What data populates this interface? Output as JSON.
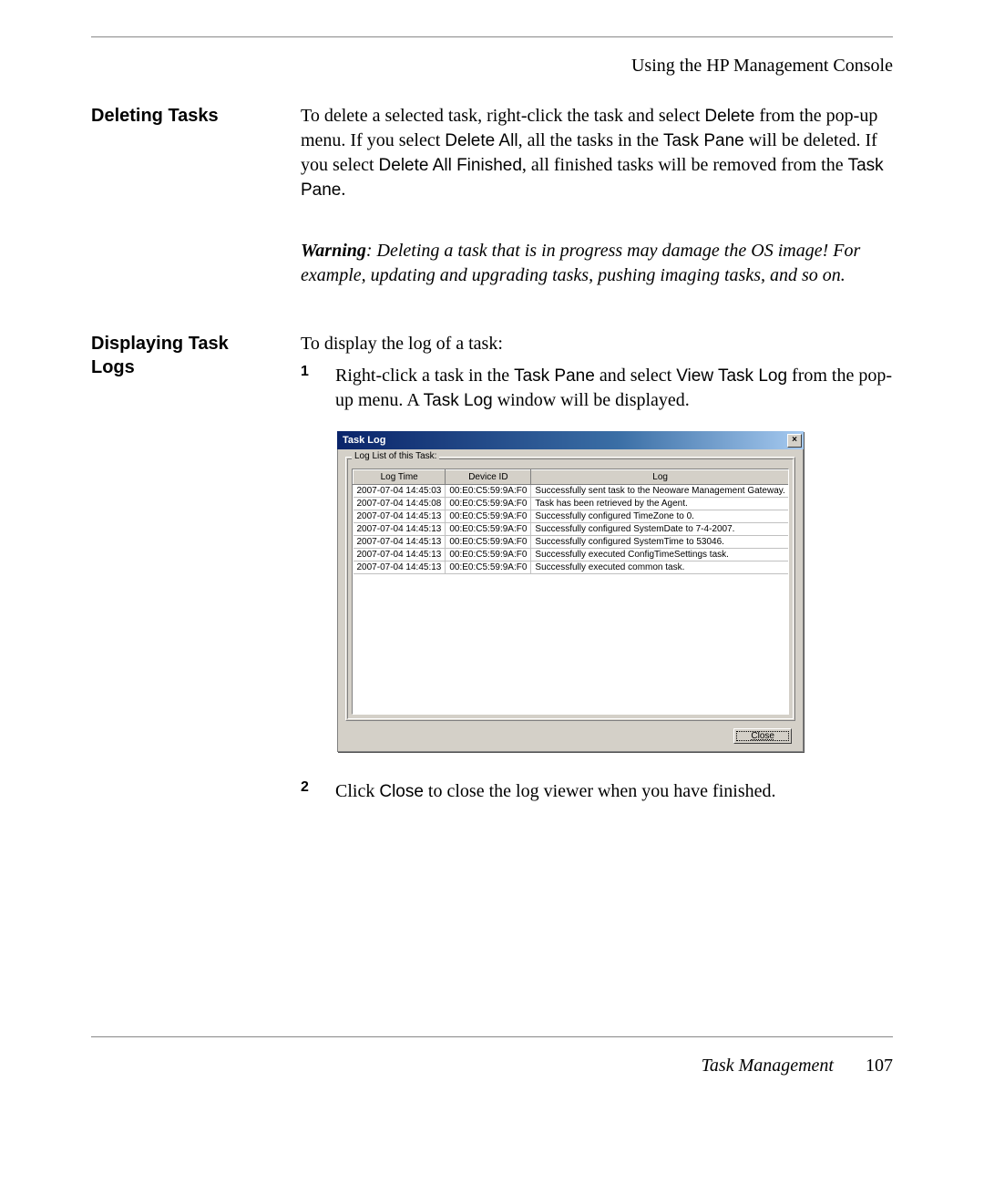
{
  "header": {
    "chapter": "Using the HP Management Console"
  },
  "section1": {
    "heading": "Deleting Tasks",
    "para_pre": "To delete a selected task, right-click the task and select ",
    "menu_delete": "Delete",
    "para_mid1": " from the pop-up menu. If you select ",
    "menu_delete_all": "Delete All",
    "para_mid2": ", all the tasks in the ",
    "task_pane": "Task Pane",
    "para_mid3": " will be deleted. If you select ",
    "menu_delete_all_finished": "Delete All Finished",
    "para_mid4": ", all finished tasks will be removed from the ",
    "para_end": ".",
    "warning_label": "Warning",
    "warning_text": ": Deleting a task that is in progress may damage the OS image! For example, updating and upgrading tasks, pushing imaging tasks, and so on."
  },
  "section2": {
    "heading": "Displaying Task Logs",
    "intro": "To display the log of a task:",
    "step1_pre": "Right-click a task in the ",
    "task_pane": "Task Pane",
    "step1_mid": " and select ",
    "view_task_log": "View Task Log",
    "step1_mid2": " from the pop-up menu. A ",
    "task_log": "Task Log",
    "step1_end": " window will be displayed.",
    "step2_pre": "Click ",
    "close_label": "Close",
    "step2_end": " to close the log viewer when you have finished."
  },
  "dialog": {
    "title": "Task Log",
    "group_label": "Log List of this Task:",
    "headers": {
      "c1": "Log Time",
      "c2": "Device ID",
      "c3": "Log"
    },
    "rows": [
      {
        "t": "2007-07-04 14:45:03",
        "d": "00:E0:C5:59:9A:F0",
        "m": "Successfully sent task to the Neoware Management Gateway."
      },
      {
        "t": "2007-07-04 14:45:08",
        "d": "00:E0:C5:59:9A:F0",
        "m": "Task has been retrieved by the Agent."
      },
      {
        "t": "2007-07-04 14:45:13",
        "d": "00:E0:C5:59:9A:F0",
        "m": "Successfully configured TimeZone to 0."
      },
      {
        "t": "2007-07-04 14:45:13",
        "d": "00:E0:C5:59:9A:F0",
        "m": "Successfully configured SystemDate to 7-4-2007."
      },
      {
        "t": "2007-07-04 14:45:13",
        "d": "00:E0:C5:59:9A:F0",
        "m": "Successfully configured SystemTime to 53046."
      },
      {
        "t": "2007-07-04 14:45:13",
        "d": "00:E0:C5:59:9A:F0",
        "m": "Successfully executed ConfigTimeSettings task."
      },
      {
        "t": "2007-07-04 14:45:13",
        "d": "00:E0:C5:59:9A:F0",
        "m": "Successfully executed common task."
      }
    ],
    "close_button": "Close"
  },
  "footer": {
    "section": "Task Management",
    "page": "107"
  }
}
